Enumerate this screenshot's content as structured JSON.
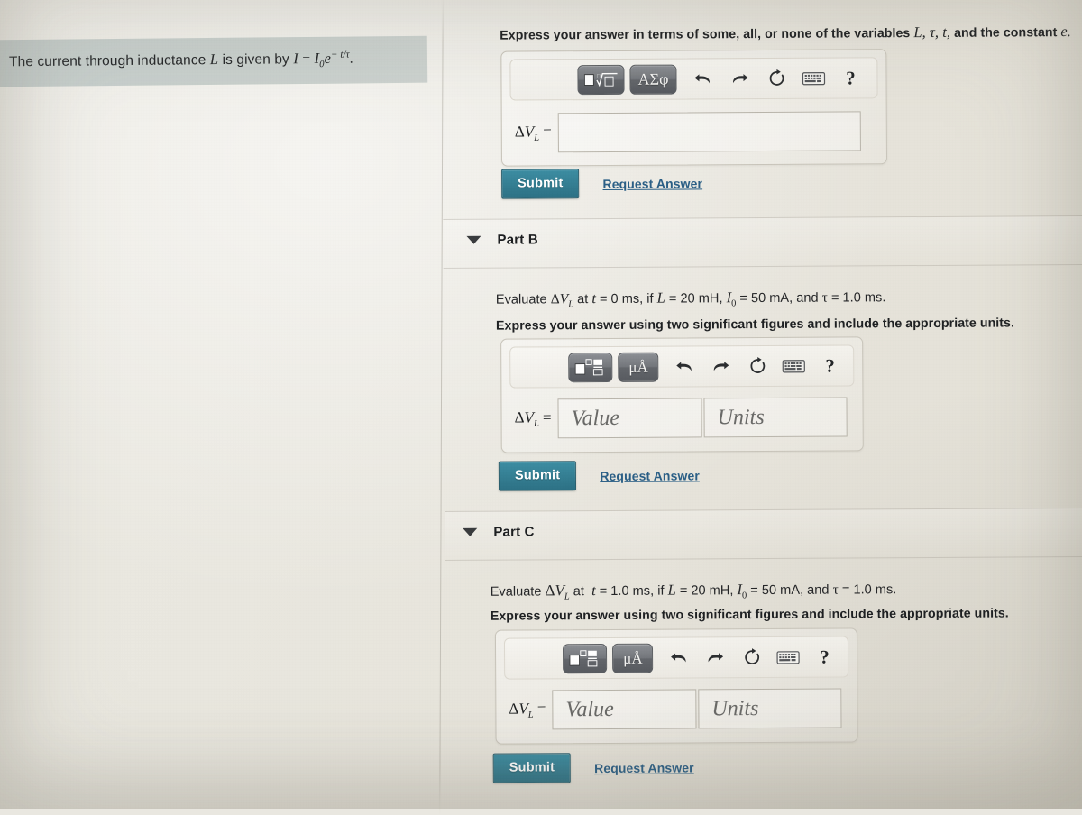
{
  "problem": {
    "text_plain": "The current through inductance L is given by I = I₀ e^(−t/τ).",
    "lead": "The current through inductance",
    "var_L": "L",
    "mid": "is given by",
    "eq_I": "I",
    "eq_eq": "=",
    "eq_I0": "I",
    "eq_I0_sub": "0",
    "eq_e": "e",
    "eq_exp": "− t/τ",
    "eq_period": "."
  },
  "partA": {
    "instruction_prefix": "Express your answer in terms of some, all, or none of the variables",
    "instruction_vars": "L, τ, t,",
    "instruction_suffix": "and the constant",
    "instruction_const": "e.",
    "answer_label_delta": "Δ",
    "answer_label_V": "V",
    "answer_label_sub": "L",
    "answer_label_eq": "=",
    "input_value": "",
    "toolbar": {
      "template_button": "√",
      "template_button_name": "nth-root-template",
      "symbols_button": "ΑΣφ",
      "undo": "undo-icon",
      "redo": "redo-icon",
      "reset": "reset-icon",
      "keyboard": "keyboard-icon",
      "help": "?"
    },
    "submit_label": "Submit",
    "request_answer_label": "Request Answer"
  },
  "partB": {
    "title": "Part B",
    "question_prefix": "Evaluate",
    "question_sym_delta": "Δ",
    "question_sym_V": "V",
    "question_sym_sub": "L",
    "question_at": "at",
    "question_t": "t",
    "question_t_val": "= 0 ms, if",
    "question_L": "L",
    "question_L_val": "= 20 mH,",
    "question_I0": "I",
    "question_I0_sub": "0",
    "question_I0_val": "= 50 mA, and",
    "question_tau": "τ",
    "question_tau_val": "= 1.0 ms.",
    "instruction": "Express your answer using two significant figures and include the appropriate units.",
    "answer_label_delta": "Δ",
    "answer_label_V": "V",
    "answer_label_sub": "L",
    "answer_label_eq": "=",
    "value_placeholder": "Value",
    "units_placeholder": "Units",
    "value_text": "",
    "units_text": "",
    "toolbar": {
      "template_button_name": "fraction-template",
      "units_button": "μÅ",
      "undo": "undo-icon",
      "redo": "redo-icon",
      "reset": "reset-icon",
      "keyboard": "keyboard-icon",
      "help": "?"
    },
    "submit_label": "Submit",
    "request_answer_label": "Request Answer"
  },
  "partC": {
    "title": "Part C",
    "question_prefix": "Evaluate",
    "question_sym_delta": "Δ",
    "question_sym_V": "V",
    "question_sym_sub": "L",
    "question_at": "at",
    "question_t": "t",
    "question_t_val": "= 1.0 ms, if",
    "question_L": "L",
    "question_L_val": "= 20 mH,",
    "question_I0": "I",
    "question_I0_sub": "0",
    "question_I0_val": "= 50 mA, and",
    "question_tau": "τ",
    "question_tau_val": "= 1.0 ms.",
    "instruction": "Express your answer using two significant figures and include the appropriate units.",
    "answer_label_delta": "Δ",
    "answer_label_V": "V",
    "answer_label_sub": "L",
    "answer_label_eq": "=",
    "value_placeholder": "Value",
    "units_placeholder": "Units",
    "value_text": "",
    "units_text": "",
    "toolbar": {
      "template_button_name": "fraction-template",
      "units_button": "μÅ",
      "undo": "undo-icon",
      "redo": "redo-icon",
      "reset": "reset-icon",
      "keyboard": "keyboard-icon",
      "help": "?"
    },
    "submit_label": "Submit",
    "request_answer_label": "Request Answer"
  },
  "colors": {
    "page_bg": "#e9e7e0",
    "highlight_bg": "#c9d0cd",
    "submit_bg": "#357f93",
    "link": "#2b5f86",
    "toolbar_button": "#6b6e73"
  }
}
